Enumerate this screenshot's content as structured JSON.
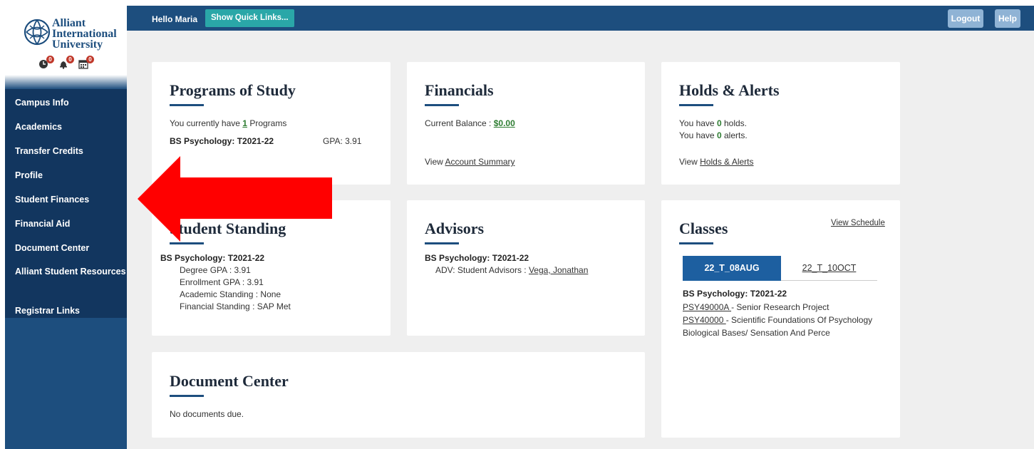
{
  "sidebar": {
    "logo": {
      "line1": "Alliant",
      "line2": "International",
      "line3": "University"
    },
    "badges": [
      {
        "icon": "clock-icon",
        "count": "0"
      },
      {
        "icon": "bell-icon",
        "count": "0"
      },
      {
        "icon": "calendar-icon",
        "count": "0"
      }
    ],
    "items": [
      {
        "label": "Campus Info"
      },
      {
        "label": "Academics"
      },
      {
        "label": "Transfer Credits"
      },
      {
        "label": "Profile"
      },
      {
        "label": "Student Finances"
      },
      {
        "label": "Financial Aid"
      },
      {
        "label": "Document Center"
      },
      {
        "label": "Alliant Student Resources"
      },
      {
        "label": "Registrar Links"
      }
    ]
  },
  "topbar": {
    "greeting": "Hello Maria",
    "quick_links": "Show Quick Links...",
    "logout": "Logout",
    "help": "Help"
  },
  "programs": {
    "title": "Programs of Study",
    "count_prefix": "You currently have ",
    "count": "1",
    "count_suffix": " Programs",
    "program": "BS Psychology: T2021-22",
    "gpa": "GPA: 3.91"
  },
  "financials": {
    "title": "Financials",
    "balance_label": "Current Balance : ",
    "balance": "$0.00",
    "view_prefix": "View ",
    "view_link": "Account Summary"
  },
  "holds": {
    "title": "Holds & Alerts",
    "holds_prefix": "You have ",
    "holds_count": "0",
    "holds_suffix": " holds.",
    "alerts_prefix": "You have ",
    "alerts_count": "0",
    "alerts_suffix": " alerts.",
    "view_prefix": "View ",
    "view_link": "Holds & Alerts"
  },
  "standing": {
    "title": "Student Standing",
    "program": "BS Psychology: T2021-22",
    "degree_gpa": "Degree GPA : 3.91",
    "enrollment_gpa": "Enrollment GPA : 3.91",
    "academic": "Academic Standing : None",
    "financial": "Financial Standing : SAP Met"
  },
  "advisors": {
    "title": "Advisors",
    "program": "BS Psychology: T2021-22",
    "advisor_label": "ADV: Student Advisors : ",
    "advisor_name": "Vega, Jonathan"
  },
  "classes": {
    "title": "Classes",
    "view_schedule": "View Schedule",
    "tabs": [
      {
        "label": "22_T_08AUG"
      },
      {
        "label": "22_T_10OCT"
      }
    ],
    "program": "BS Psychology: T2021-22",
    "courses": [
      {
        "code": "PSY49000A ",
        "desc": "- Senior Research Project"
      },
      {
        "code": "PSY40000 ",
        "desc": "- Scientific Foundations Of Psychology"
      }
    ],
    "extra": "Biological Bases/ Sensation And Perce"
  },
  "documents": {
    "title": "Document Center",
    "status": "No documents due."
  },
  "colors": {
    "navy": "#1d4e7e",
    "nav_dark": "#12365f",
    "teal": "#2aa7a8",
    "arrow": "#ff0000"
  }
}
